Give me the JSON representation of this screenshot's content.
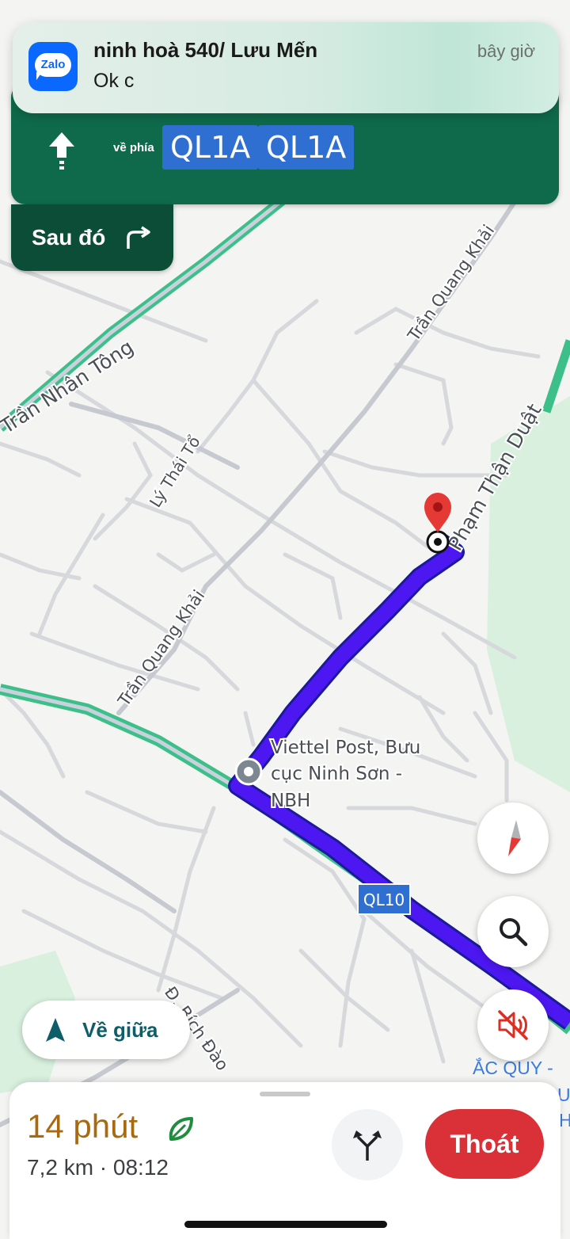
{
  "notification": {
    "app_icon_text": "Zalo",
    "title": "ninh hoà 540/ Lưu Mến",
    "message": "Ok c",
    "time": "bây giờ"
  },
  "navigation": {
    "toward_label": "về phía",
    "road_shields": [
      "QL1A",
      "QL1A"
    ],
    "then_label": "Sau đó",
    "maneuver_icon": "arrow-straight-icon",
    "then_icon": "turn-right-icon"
  },
  "map": {
    "streets": {
      "tran_nhan_tong": "Trần Nhân Tông",
      "tran_quang_khai_upper": "Trần Quang Khải",
      "tran_quang_khai_lower": "Trần Quang Khải",
      "ly_thai_to": "Lý Thái Tổ",
      "pham_than_duat": "Phạm Thận Duật",
      "bich_dao": "Đ. Bích Đào"
    },
    "route_shield": "QL10",
    "poi": {
      "name_line1": "Viettel Post, Bưu",
      "name_line2": "cục Ninh Sơn -",
      "name_line3": "NBH"
    },
    "edge_label": "ẮC QUY -",
    "edge_letters": [
      "U",
      "H"
    ],
    "colors": {
      "route": "#4c17f0",
      "highway": "#3dbf8a",
      "destination_pin": "#e53935"
    }
  },
  "controls": {
    "compass_icon": "compass-icon",
    "search_icon": "search-icon",
    "sound_icon": "sound-off-icon",
    "recenter_label": "Về giữa"
  },
  "trip": {
    "eta_duration": "14 phút",
    "eco_icon": "eco-leaf-icon",
    "distance_arrival": "7,2 km · 08:12",
    "exit_label": "Thoát"
  }
}
